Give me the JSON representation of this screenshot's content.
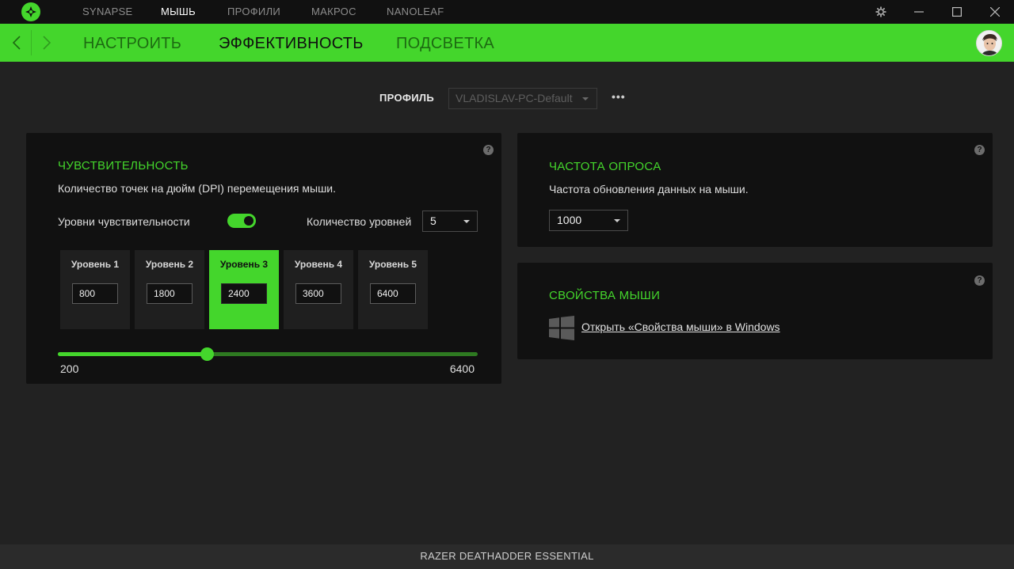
{
  "topnav": {
    "items": [
      {
        "label": "SYNAPSE",
        "active": false
      },
      {
        "label": "МЫШЬ",
        "active": true
      },
      {
        "label": "ПРОФИЛИ",
        "active": false
      },
      {
        "label": "МАКРОС",
        "active": false
      },
      {
        "label": "NANOLEAF",
        "active": false
      }
    ]
  },
  "subnav": {
    "tabs": [
      {
        "label": "НАСТРОИТЬ",
        "active": false
      },
      {
        "label": "ЭФФЕКТИВНОСТЬ",
        "active": true
      },
      {
        "label": "ПОДСВЕТКА",
        "active": false
      }
    ]
  },
  "profile": {
    "label": "ПРОФИЛЬ",
    "selected": "VLADISLAV-PC-Default",
    "more": "•••"
  },
  "sensitivity": {
    "title": "ЧУВСТВИТЕЛЬНОСТЬ",
    "description": "Количество точек на дюйм (DPI) перемещения мыши.",
    "stages_label": "Уровни чувствительности",
    "stages_enabled": true,
    "count_label": "Количество уровней",
    "count_value": "5",
    "active_stage": 3,
    "stages": [
      {
        "label": "Уровень 1",
        "value": "800"
      },
      {
        "label": "Уровень 2",
        "value": "1800"
      },
      {
        "label": "Уровень 3",
        "value": "2400"
      },
      {
        "label": "Уровень 4",
        "value": "3600"
      },
      {
        "label": "Уровень 5",
        "value": "6400"
      }
    ],
    "slider": {
      "min": "200",
      "max": "6400",
      "value": 2400
    }
  },
  "polling": {
    "title": "ЧАСТОТА ОПРОСА",
    "description": "Частота обновления данных на мыши.",
    "value": "1000"
  },
  "mouse_props": {
    "title": "СВОЙСТВА МЫШИ",
    "link": "Открыть «Свойства мыши» в Windows"
  },
  "footer": {
    "device": "RAZER DEATHADDER ESSENTIAL"
  },
  "colors": {
    "accent": "#44d62c",
    "panel": "#111111",
    "background": "#222222"
  }
}
